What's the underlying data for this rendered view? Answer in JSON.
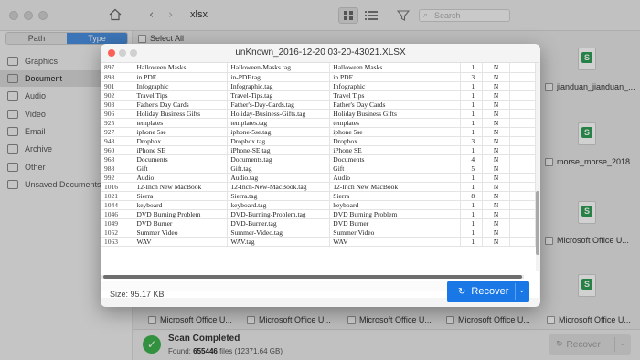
{
  "toolbar": {
    "path_title": "xlsx",
    "search_placeholder": "Search"
  },
  "sidebar": {
    "tabs": [
      {
        "label": "Path"
      },
      {
        "label": "Type"
      }
    ],
    "items": [
      {
        "label": "Graphics"
      },
      {
        "label": "Document"
      },
      {
        "label": "Audio"
      },
      {
        "label": "Video"
      },
      {
        "label": "Email"
      },
      {
        "label": "Archive"
      },
      {
        "label": "Other"
      },
      {
        "label": "Unsaved Documents"
      }
    ]
  },
  "content": {
    "select_all_label": "Select All",
    "right_cards": [
      {
        "label": "jianduan_jianduan_..."
      },
      {
        "label": "morse_morse_2018..."
      },
      {
        "label": "Microsoft Office U..."
      }
    ],
    "bottom_row": [
      {
        "label": "Microsoft Office U..."
      },
      {
        "label": "Microsoft Office U..."
      },
      {
        "label": "Microsoft Office U..."
      },
      {
        "label": "Microsoft Office U..."
      },
      {
        "label": "Microsoft Office U..."
      }
    ]
  },
  "status": {
    "title": "Scan Completed",
    "found_prefix": "Found: ",
    "found_count": "655446",
    "found_suffix": " files (12371.64 GB)",
    "recover_label": "Recover"
  },
  "dialog": {
    "title": "unKnown_2016-12-20 03-20-43021.XLSX",
    "size_label": "Size: 95.17 KB",
    "recover_label": "Recover",
    "rows": [
      {
        "id": "897",
        "name": "Halloween Masks",
        "tag": "Halloween-Masks.tag",
        "tag2": "Halloween Masks",
        "count": "1",
        "flag": "N"
      },
      {
        "id": "898",
        "name": "in PDF",
        "tag": "in-PDF.tag",
        "tag2": "in PDF",
        "count": "3",
        "flag": "N"
      },
      {
        "id": "901",
        "name": "Infographic",
        "tag": "Infographic.tag",
        "tag2": "Infographic",
        "count": "1",
        "flag": "N"
      },
      {
        "id": "902",
        "name": "Travel Tips",
        "tag": "Travel-Tips.tag",
        "tag2": "Travel Tips",
        "count": "1",
        "flag": "N"
      },
      {
        "id": "903",
        "name": "Father's Day Cards",
        "tag": "Father's-Day-Cards.tag",
        "tag2": "Father's Day Cards",
        "count": "1",
        "flag": "N"
      },
      {
        "id": "906",
        "name": "Holiday Business Gifts",
        "tag": "Holiday-Business-Gifts.tag",
        "tag2": "Holiday Business Gifts",
        "count": "1",
        "flag": "N"
      },
      {
        "id": "925",
        "name": "templates",
        "tag": "templates.tag",
        "tag2": "templates",
        "count": "1",
        "flag": "N"
      },
      {
        "id": "927",
        "name": "iphone 5se",
        "tag": "iphone-5se.tag",
        "tag2": "iphone 5se",
        "count": "1",
        "flag": "N"
      },
      {
        "id": "948",
        "name": "Dropbox",
        "tag": "Dropbox.tag",
        "tag2": "Dropbox",
        "count": "3",
        "flag": "N"
      },
      {
        "id": "960",
        "name": "iPhone SE",
        "tag": "iPhone-SE.tag",
        "tag2": "iPhone SE",
        "count": "1",
        "flag": "N"
      },
      {
        "id": "968",
        "name": "Documents",
        "tag": "Documents.tag",
        "tag2": "Documents",
        "count": "4",
        "flag": "N"
      },
      {
        "id": "988",
        "name": "Gift",
        "tag": "Gift.tag",
        "tag2": "Gift",
        "count": "5",
        "flag": "N"
      },
      {
        "id": "992",
        "name": "Audio",
        "tag": "Audio.tag",
        "tag2": "Audio",
        "count": "1",
        "flag": "N"
      },
      {
        "id": "1016",
        "name": "12-Inch New MacBook",
        "tag": "12-Inch-New-MacBook.tag",
        "tag2": "12-Inch New MacBook",
        "count": "1",
        "flag": "N"
      },
      {
        "id": "1021",
        "name": "Sierra",
        "tag": "Sierra.tag",
        "tag2": "Sierra",
        "count": "8",
        "flag": "N"
      },
      {
        "id": "1044",
        "name": "keyboard",
        "tag": "keyboard.tag",
        "tag2": "keyboard",
        "count": "1",
        "flag": "N"
      },
      {
        "id": "1046",
        "name": "DVD Burning Problem",
        "tag": "DVD-Burning-Problem.tag",
        "tag2": "DVD Burning Problem",
        "count": "1",
        "flag": "N"
      },
      {
        "id": "1049",
        "name": "DVD Burner",
        "tag": "DVD-Burner.tag",
        "tag2": "DVD Burner",
        "count": "1",
        "flag": "N"
      },
      {
        "id": "1052",
        "name": "Summer Video",
        "tag": "Summer-Video.tag",
        "tag2": "Summer Video",
        "count": "1",
        "flag": "N"
      },
      {
        "id": "1063",
        "name": "WAV",
        "tag": "WAV.tag",
        "tag2": "WAV",
        "count": "1",
        "flag": "N"
      }
    ]
  },
  "colors": {
    "accent": "#1a78e6",
    "tab_active": "#4a8fe0",
    "success": "#3db14c",
    "xls_green": "#2e9e55",
    "close_dot": "#fd5f57"
  }
}
